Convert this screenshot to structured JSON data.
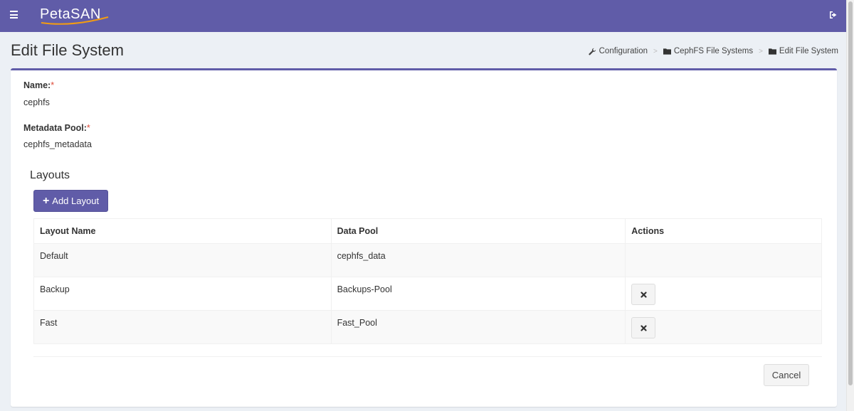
{
  "header": {
    "logo_text": "PetaSAN",
    "menu_icon": "hamburger-menu-icon",
    "logout_icon": "sign-out-icon",
    "bar_color": "#605ca8"
  },
  "page": {
    "title": "Edit File System",
    "breadcrumb": [
      {
        "label": "Configuration",
        "icon": "wrench-icon"
      },
      {
        "label": "CephFS File Systems",
        "icon": "folder-icon"
      },
      {
        "label": "Edit File System",
        "icon": "folder-icon"
      }
    ]
  },
  "form": {
    "name_label": "Name:",
    "name_value": "cephfs",
    "metadata_label": "Metadata Pool:",
    "metadata_value": "cephfs_metadata",
    "required_mark": "*"
  },
  "layouts": {
    "title": "Layouts",
    "add_button": "Add Layout",
    "columns": [
      "Layout Name",
      "Data Pool",
      "Actions"
    ],
    "rows": [
      {
        "name": "Default",
        "pool": "cephfs_data",
        "deletable": false
      },
      {
        "name": "Backup",
        "pool": "Backups-Pool",
        "deletable": true
      },
      {
        "name": "Fast",
        "pool": "Fast_Pool",
        "deletable": true
      }
    ]
  },
  "footer": {
    "cancel_button": "Cancel"
  }
}
